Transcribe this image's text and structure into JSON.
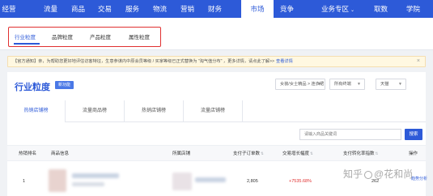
{
  "topnav": {
    "items": [
      {
        "label": "经营",
        "chev": ""
      },
      {
        "label": "流量",
        "chev": ""
      },
      {
        "label": "商品",
        "chev": ""
      },
      {
        "label": "交易",
        "chev": ""
      },
      {
        "label": "服务",
        "chev": ""
      },
      {
        "label": "物流",
        "chev": ""
      },
      {
        "label": "营销",
        "chev": ""
      },
      {
        "label": "财务",
        "chev": ""
      },
      {
        "label": "市场",
        "chev": ""
      },
      {
        "label": "竞争",
        "chev": ""
      },
      {
        "label": "业务专区",
        "chev": "⌄"
      },
      {
        "label": "取数",
        "chev": ""
      },
      {
        "label": "学院",
        "chev": ""
      }
    ],
    "active": "市场"
  },
  "subnav": {
    "items": [
      "行业粒度",
      "品牌粒度",
      "产品粒度",
      "属性粒度"
    ],
    "active": "行业粒度"
  },
  "notice": {
    "text": "【官方通知】亲，为帮助您更好地评估访客特征，生意参谋内中原会员等级 / 买家等级已正式替换为 \"淘气值分布\" ，更多详情，请点此了解>>",
    "link": "查看详情",
    "close": "×"
  },
  "section": {
    "title": "行业粒度",
    "badge": "新功能",
    "category_select": "女装/女士精品 > 连衣裙",
    "terminal_select": "所有终端",
    "period_select": "天猫"
  },
  "tabs": [
    "热销店铺榜",
    "流量商品榜",
    "热销店铺榜",
    "流量店铺榜"
  ],
  "search": {
    "placeholder": "请输入商品关键词",
    "button": "搜索"
  },
  "table": {
    "headers": {
      "rank": "热销排名",
      "product": "商品信息",
      "shop": "所属店铺",
      "orders": "支付子订单数",
      "growth": "交易增长幅度",
      "conversion": "支付转化率指数",
      "action": "操作"
    },
    "rows": [
      {
        "rank": "1",
        "orders": "2,805",
        "growth": "+7535.68%",
        "conversion": "262",
        "action": "趋势分析"
      }
    ]
  },
  "watermark": {
    "text_a": "知乎",
    "text_b": "@花和尚"
  },
  "colors": {
    "brand": "#2d5ad8",
    "highlight": "#e03030"
  }
}
